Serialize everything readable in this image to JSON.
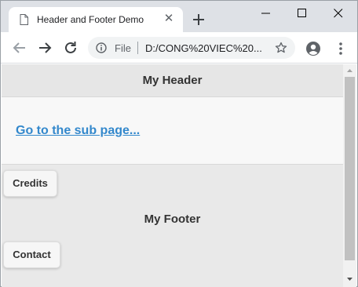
{
  "browser": {
    "tab_title": "Header and Footer Demo",
    "tab_close_glyph": "✕",
    "url_scheme": "File",
    "url": "D:/CONG%20VIEC%20...",
    "icons": [
      "page-icon",
      "close-icon",
      "plus-icon",
      "minimize-icon",
      "maximize-icon",
      "close-window-icon",
      "back-arrow-icon",
      "forward-arrow-icon",
      "reload-icon",
      "info-icon",
      "star-icon",
      "account-icon",
      "menu-dots-icon"
    ]
  },
  "page": {
    "header_title": "My Header",
    "link_text": "Go to the sub page...",
    "footer_title": "My Footer",
    "credits_label": "Credits",
    "contact_label": "Contact"
  },
  "colors": {
    "link": "#3388cc",
    "tabstrip": "#dee1e6",
    "header_bg": "#e6e6e6",
    "content_bg": "#f8f8f8",
    "footer_bg": "#e9e9e9"
  }
}
